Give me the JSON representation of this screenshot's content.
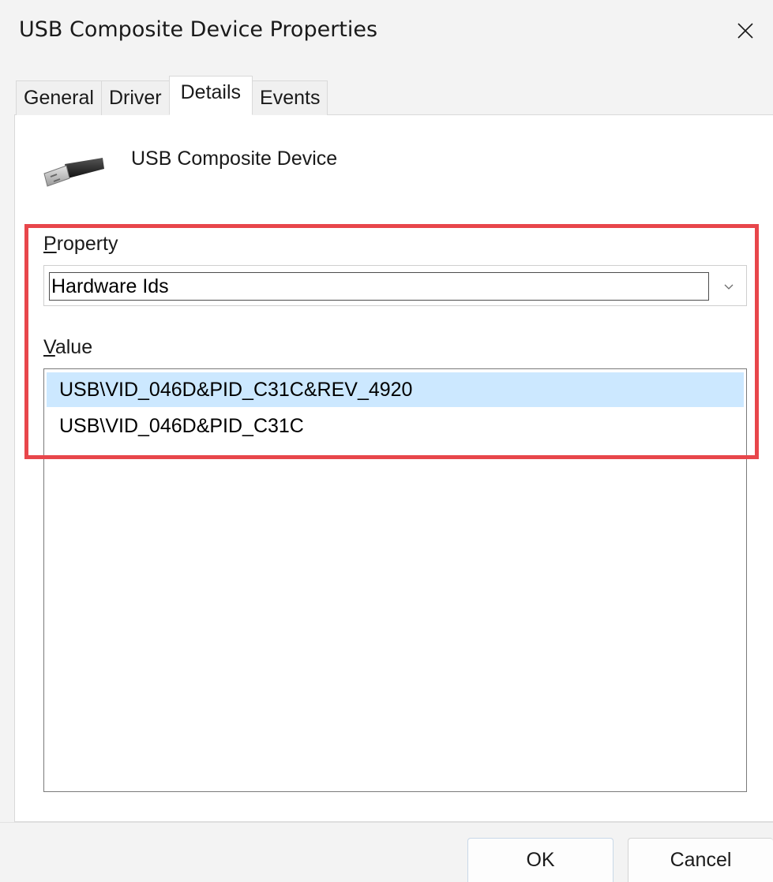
{
  "window": {
    "title": "USB Composite Device Properties"
  },
  "tabs": [
    {
      "label": "General",
      "active": false
    },
    {
      "label": "Driver",
      "active": false
    },
    {
      "label": "Details",
      "active": true
    },
    {
      "label": "Events",
      "active": false
    }
  ],
  "device": {
    "icon": "usb-connector-icon",
    "name": "USB Composite Device"
  },
  "property": {
    "label_accel": "P",
    "label_rest": "roperty",
    "selected": "Hardware Ids"
  },
  "value": {
    "label_accel": "V",
    "label_rest": "alue",
    "items": [
      {
        "text": "USB\\VID_046D&PID_C31C&REV_4920",
        "selected": true
      },
      {
        "text": "USB\\VID_046D&PID_C31C",
        "selected": false
      }
    ]
  },
  "buttons": {
    "ok": "OK",
    "cancel": "Cancel"
  },
  "colors": {
    "highlight": "#e8464b",
    "selection": "#cce8ff"
  }
}
